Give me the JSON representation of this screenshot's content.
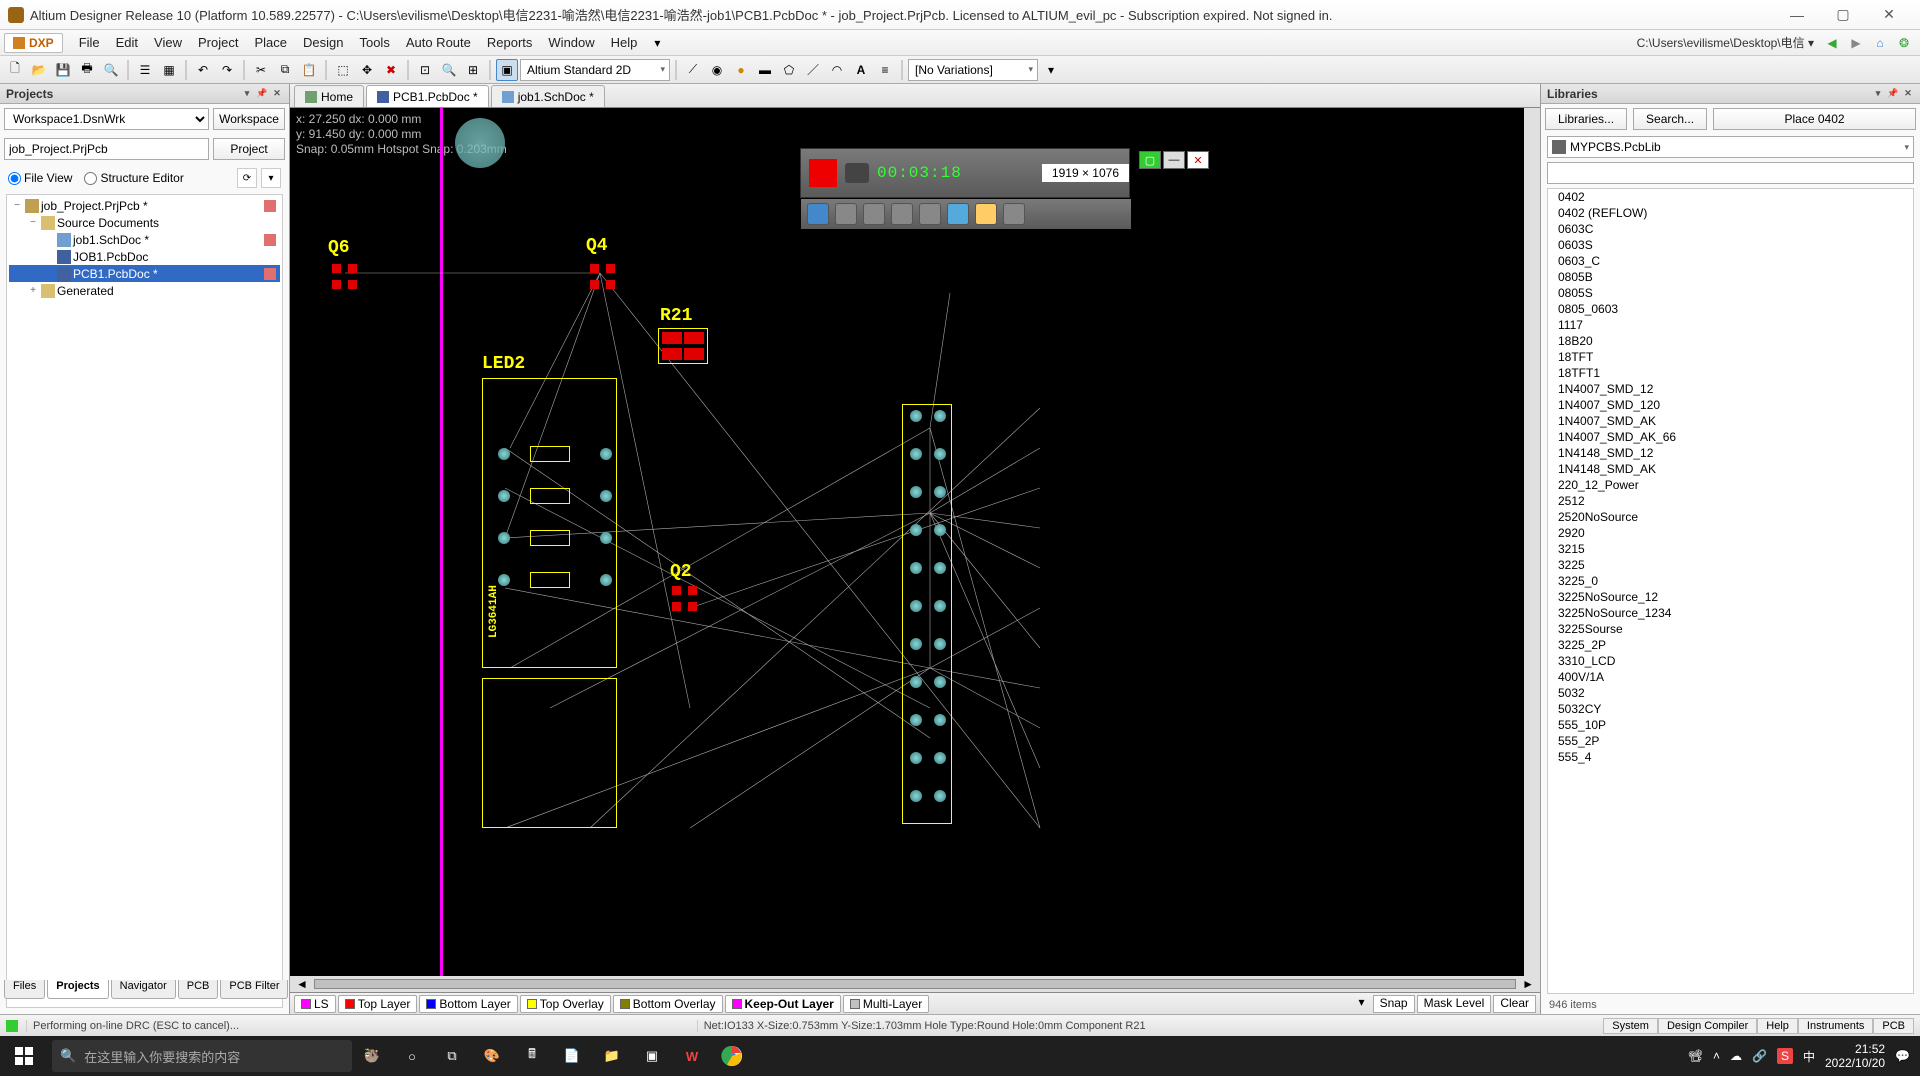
{
  "title": "Altium Designer Release 10 (Platform 10.589.22577) - C:\\Users\\evilisme\\Desktop\\电信2231-喻浩然\\电信2231-喻浩然-job1\\PCB1.PcbDoc * - job_Project.PrjPcb. Licensed to ALTIUM_evil_pc - Subscription expired. Not signed in.",
  "menubar": {
    "dxp": "DXP",
    "items": [
      "File",
      "Edit",
      "View",
      "Project",
      "Place",
      "Design",
      "Tools",
      "Auto Route",
      "Reports",
      "Window",
      "Help"
    ],
    "path": "C:\\Users\\evilisme\\Desktop\\电信 ▾"
  },
  "toolbar": {
    "viewmode": "Altium Standard 2D",
    "variations": "[No Variations]"
  },
  "projects": {
    "title": "Projects",
    "workspace": "Workspace1.DsnWrk",
    "workspace_btn": "Workspace",
    "project": "job_Project.PrjPcb",
    "project_btn": "Project",
    "fileview": "File View",
    "structure": "Structure Editor",
    "tree": [
      {
        "d": 0,
        "exp": "−",
        "label": "job_Project.PrjPcb *",
        "icon": "#c0a050",
        "mark": "#e07070"
      },
      {
        "d": 1,
        "exp": "−",
        "label": "Source Documents",
        "icon": "#d8c070"
      },
      {
        "d": 2,
        "exp": "",
        "label": "job1.SchDoc *",
        "icon": "#70a0d0",
        "mark": "#e07070"
      },
      {
        "d": 2,
        "exp": "",
        "label": "JOB1.PcbDoc",
        "icon": "#4060a0"
      },
      {
        "d": 2,
        "exp": "",
        "label": "PCB1.PcbDoc *",
        "icon": "#4060a0",
        "sel": true,
        "mark": "#e07070"
      },
      {
        "d": 1,
        "exp": "+",
        "label": "Generated",
        "icon": "#d8c070"
      }
    ],
    "bottom_tabs": [
      "Files",
      "Projects",
      "Navigator",
      "PCB",
      "PCB Filter"
    ]
  },
  "editor": {
    "tabs": [
      {
        "label": "Home",
        "icon": "#70a070"
      },
      {
        "label": "PCB1.PcbDoc *",
        "icon": "#4060a0",
        "active": true
      },
      {
        "label": "job1.SchDoc *",
        "icon": "#70a0d0"
      }
    ],
    "coords": {
      "l1": "x: 27.250   dx: 0.000 mm",
      "l2": "y: 91.450   dy: 0.000 mm",
      "l3": "Snap: 0.05mm  Hotspot Snap: 0.203mm"
    },
    "designators": {
      "q6": "Q6",
      "q4": "Q4",
      "r21": "R21",
      "led2": "LED2",
      "q2": "Q2",
      "lg": "LG3641AH"
    }
  },
  "layers": {
    "ls": "LS",
    "items": [
      {
        "label": "Top Layer",
        "color": "#ff0000"
      },
      {
        "label": "Bottom Layer",
        "color": "#0000ff"
      },
      {
        "label": "Top Overlay",
        "color": "#ffff00"
      },
      {
        "label": "Bottom Overlay",
        "color": "#808000"
      },
      {
        "label": "Keep-Out Layer",
        "color": "#ff00ff",
        "active": true
      },
      {
        "label": "Multi-Layer",
        "color": "#c0c0c0"
      }
    ],
    "right": [
      "Snap",
      "Mask Level",
      "Clear"
    ]
  },
  "libraries": {
    "title": "Libraries",
    "libraries_btn": "Libraries...",
    "search_btn": "Search...",
    "place_btn": "Place 0402",
    "selected": "MYPCBS.PcbLib",
    "items": [
      "0402",
      "0402 (REFLOW)",
      "0603C",
      "0603S",
      "0603_C",
      "0805B",
      "0805S",
      "0805_0603",
      "1117",
      "18B20",
      "18TFT",
      "18TFT1",
      "1N4007_SMD_12",
      "1N4007_SMD_120",
      "1N4007_SMD_AK",
      "1N4007_SMD_AK_66",
      "1N4148_SMD_12",
      "1N4148_SMD_AK",
      "220_12_Power",
      "2512",
      "2520NoSource",
      "2920",
      "3215",
      "3225",
      "3225_0",
      "3225NoSource_12",
      "3225NoSource_1234",
      "3225Sourse",
      "3225_2P",
      "3310_LCD",
      "400V/1A",
      "5032",
      "5032CY",
      "555_10P",
      "555_2P",
      "555_4"
    ],
    "count": "946 items"
  },
  "status": {
    "msg": "Performing on-line DRC (ESC to cancel)...",
    "net": "Net:IO133 X-Size:0.753mm Y-Size:1.703mm Hole Type:Round Hole:0mm   Component R21",
    "btns": [
      "System",
      "Design Compiler",
      "Help",
      "Instruments",
      "PCB"
    ]
  },
  "recorder": {
    "timer": "00:03:18",
    "dim": "1919 × 1076"
  },
  "taskbar": {
    "search_placeholder": "在这里输入你要搜索的内容",
    "time": "21:52",
    "date": "2022/10/20",
    "ime": "中"
  }
}
